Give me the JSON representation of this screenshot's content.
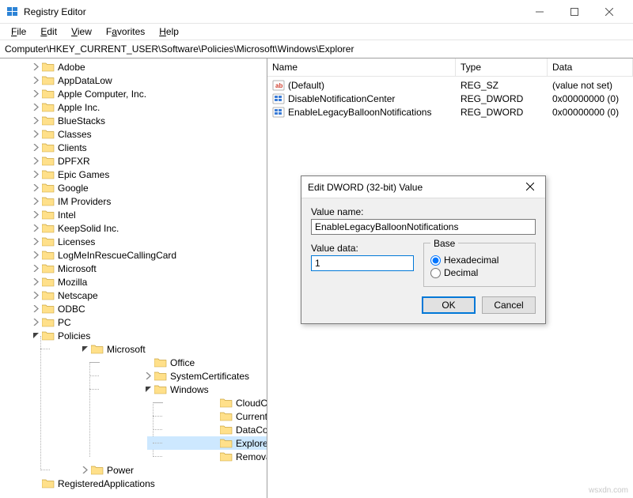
{
  "window": {
    "title": "Registry Editor"
  },
  "menu": {
    "file": "File",
    "edit": "Edit",
    "view": "View",
    "favorites": "Favorites",
    "help": "Help"
  },
  "address": "Computer\\HKEY_CURRENT_USER\\Software\\Policies\\Microsoft\\Windows\\Explorer",
  "tree": {
    "top": [
      "Adobe",
      "AppDataLow",
      "Apple Computer, Inc.",
      "Apple Inc.",
      "BlueStacks",
      "Classes",
      "Clients",
      "DPFXR",
      "Epic Games",
      "Google",
      "IM Providers",
      "Intel",
      "KeepSolid Inc.",
      "Licenses",
      "LogMeInRescueCallingCard",
      "Microsoft",
      "Mozilla",
      "Netscape",
      "ODBC",
      "PC"
    ],
    "policies": "Policies",
    "policies_children": {
      "microsoft": "Microsoft",
      "microsoft_children": {
        "office": "Office",
        "syscert": "SystemCertificates",
        "windows": "Windows",
        "windows_children": [
          "CloudContent",
          "CurrentVersion",
          "DataCollection",
          "Explorer",
          "RemovableStorageDevices"
        ]
      },
      "power": "Power"
    },
    "regapps": "RegisteredApplications"
  },
  "list": {
    "cols": {
      "name": "Name",
      "type": "Type",
      "data": "Data"
    },
    "rows": [
      {
        "icon": "string",
        "name": "(Default)",
        "type": "REG_SZ",
        "data": "(value not set)"
      },
      {
        "icon": "dword",
        "name": "DisableNotificationCenter",
        "type": "REG_DWORD",
        "data": "0x00000000 (0)"
      },
      {
        "icon": "dword",
        "name": "EnableLegacyBalloonNotifications",
        "type": "REG_DWORD",
        "data": "0x00000000 (0)"
      }
    ]
  },
  "dialog": {
    "title": "Edit DWORD (32-bit) Value",
    "value_name_label": "Value name:",
    "value_name": "EnableLegacyBalloonNotifications",
    "value_data_label": "Value data:",
    "value_data": "1",
    "base_label": "Base",
    "hex": "Hexadecimal",
    "dec": "Decimal",
    "base_selected": "hex",
    "ok": "OK",
    "cancel": "Cancel"
  },
  "watermark": "wsxdn.com"
}
